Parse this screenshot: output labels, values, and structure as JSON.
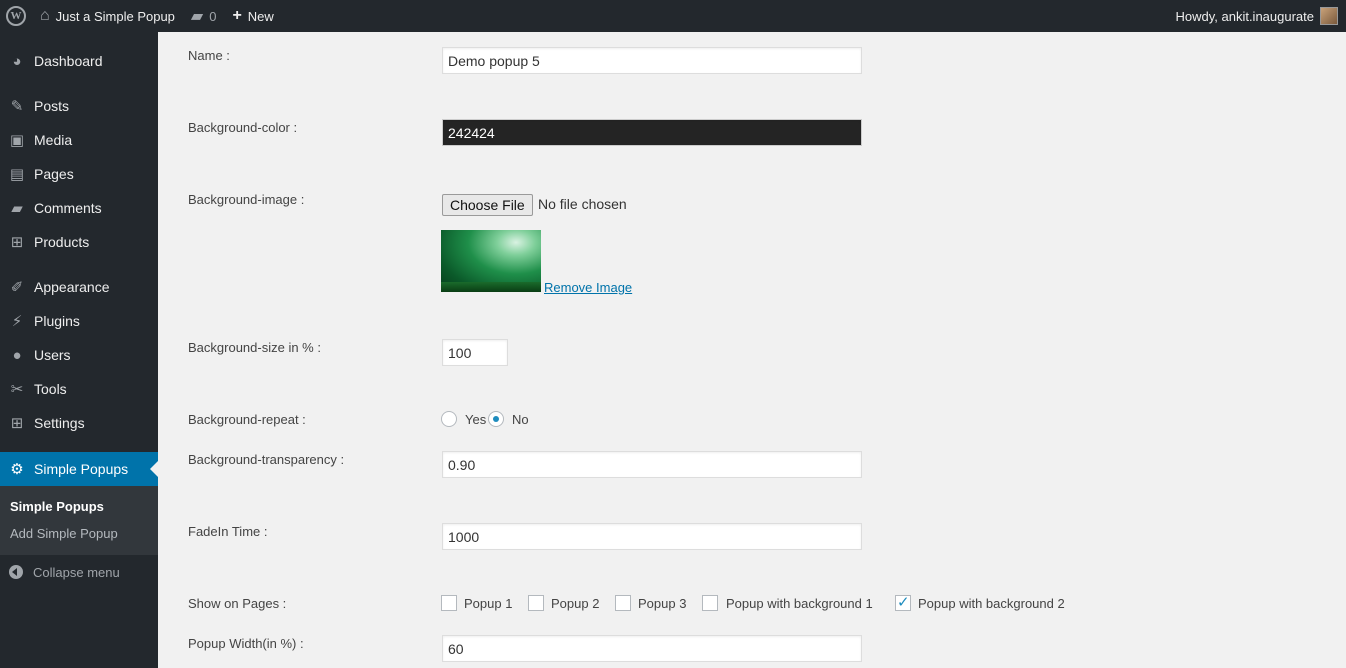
{
  "adminbar": {
    "site_name": "Just a Simple Popup",
    "comments_count": "0",
    "new_label": "New",
    "howdy": "Howdy, ankit.inaugurate"
  },
  "sidebar": {
    "items": [
      {
        "label": "Dashboard",
        "icon": "dashboard-icon"
      },
      {
        "label": "Posts",
        "icon": "pin-icon"
      },
      {
        "label": "Media",
        "icon": "media-icon"
      },
      {
        "label": "Pages",
        "icon": "pages-icon"
      },
      {
        "label": "Comments",
        "icon": "comment-icon"
      },
      {
        "label": "Products",
        "icon": "cart-icon"
      },
      {
        "label": "Appearance",
        "icon": "brush-icon"
      },
      {
        "label": "Plugins",
        "icon": "plug-icon"
      },
      {
        "label": "Users",
        "icon": "users-icon"
      },
      {
        "label": "Tools",
        "icon": "wrench-icon"
      },
      {
        "label": "Settings",
        "icon": "settings-icon"
      },
      {
        "label": "Simple Popups",
        "icon": "gear-icon"
      }
    ],
    "submenu": [
      "Simple Popups",
      "Add Simple Popup"
    ],
    "collapse": "Collapse menu"
  },
  "form": {
    "name_label": "Name :",
    "name_value": "Demo popup 5",
    "bgcolor_label": "Background-color :",
    "bgcolor_value": "242424",
    "bgimage_label": "Background-image :",
    "choose_file": "Choose File",
    "no_file": "No file chosen",
    "remove_image": "Remove Image",
    "bgsize_label": "Background-size in % :",
    "bgsize_value": "100",
    "bgrepeat_label": "Background-repeat :",
    "repeat_yes": "Yes",
    "repeat_no": "No",
    "transparency_label": "Background-transparency :",
    "transparency_value": "0.90",
    "fadein_label": "FadeIn Time :",
    "fadein_value": "1000",
    "show_pages_label": "Show on Pages :",
    "pages": [
      {
        "label": "Popup 1",
        "checked": false
      },
      {
        "label": "Popup 2",
        "checked": false
      },
      {
        "label": "Popup 3",
        "checked": false
      },
      {
        "label": "Popup with background 1",
        "checked": false
      },
      {
        "label": "Popup with background 2",
        "checked": true
      }
    ],
    "width_label": "Popup Width(in %) :",
    "width_value": "60"
  },
  "colors": {
    "adminbar_bg": "#23282d",
    "accent": "#0073aa",
    "bg_color_field": "#242424"
  }
}
